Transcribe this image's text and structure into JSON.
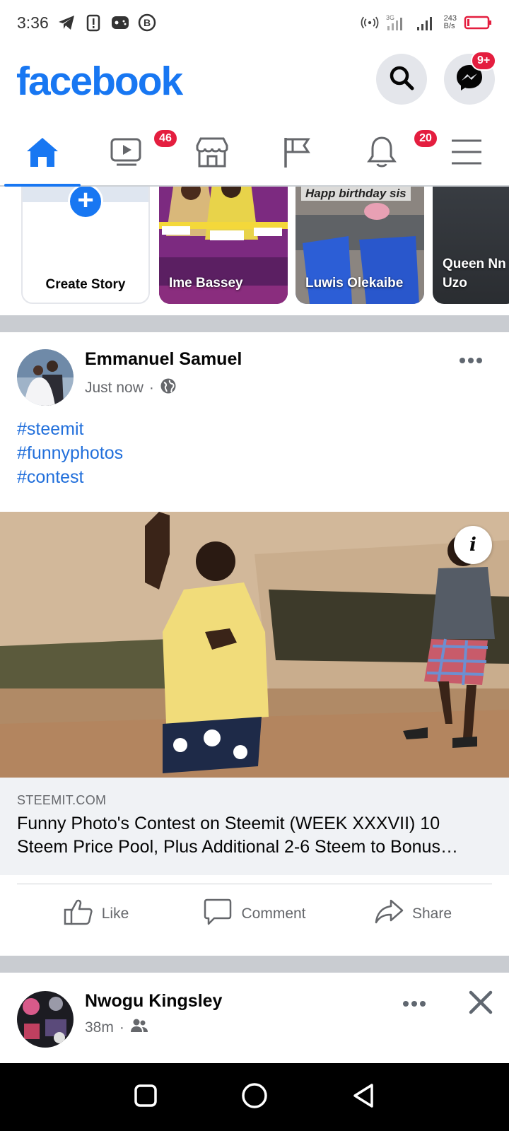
{
  "status_bar": {
    "time": "3:36",
    "net_speed_value": "243",
    "net_speed_unit": "B/s",
    "network_type": "3G"
  },
  "header": {
    "logo": "facebook",
    "messenger_badge": "9+"
  },
  "tabs": [
    {
      "name": "home",
      "active": true
    },
    {
      "name": "watch",
      "badge": "46"
    },
    {
      "name": "marketplace"
    },
    {
      "name": "pages"
    },
    {
      "name": "notifications",
      "badge": "20"
    },
    {
      "name": "menu"
    }
  ],
  "stories": {
    "create_label": "Create Story",
    "items": [
      {
        "name": "Ime Bassey"
      },
      {
        "name": "Luwis Olekaibe",
        "caption": "Happ birthday sis"
      },
      {
        "name": "Queen Nn Uzo",
        "name_line1": "Queen Nn",
        "name_line2": "Uzo"
      }
    ]
  },
  "post1": {
    "author": "Emmanuel Samuel",
    "time": "Just now",
    "separator": "·",
    "hashtags": [
      "#steemit",
      "#funnyphotos",
      "#contest"
    ],
    "link": {
      "domain": "STEEMIT.COM",
      "title": "Funny Photo's Contest on Steemit (WEEK XXXVII) 10 Steem Price Pool, Plus Additional 2-6 Steem to Bonus…"
    },
    "actions": {
      "like": "Like",
      "comment": "Comment",
      "share": "Share"
    },
    "info_glyph": "i"
  },
  "post2": {
    "author": "Nwogu Kingsley",
    "time": "38m",
    "separator": "·"
  },
  "colors": {
    "brand": "#1877f2",
    "badge": "#e41e3f",
    "hashtag": "#216fdb",
    "muted": "#65676b"
  }
}
